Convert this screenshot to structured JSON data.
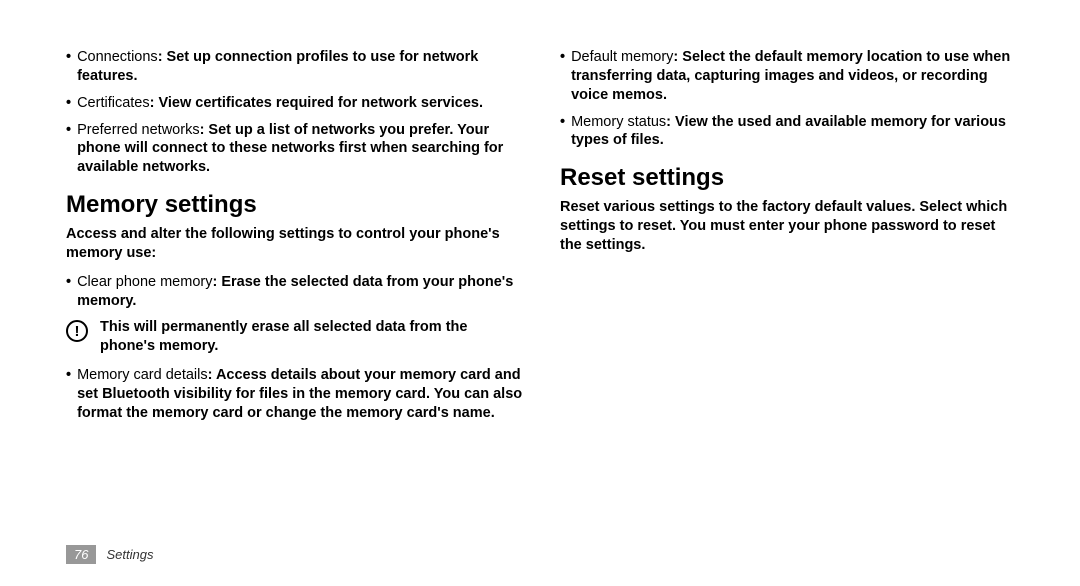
{
  "left_col": {
    "bullets_top": [
      {
        "label": "Connections",
        "desc": ": Set up connection profiles to use for network features."
      },
      {
        "label": "Certificates",
        "desc": ": View certificates required for network services."
      },
      {
        "label": "Preferred networks",
        "desc": ": Set up a list of networks you prefer. Your phone will connect to these networks first when searching for available networks."
      }
    ],
    "heading": "Memory settings",
    "intro": "Access and alter the following settings to control your phone's memory use:",
    "bullets_after": [
      {
        "label": "Clear phone memory",
        "desc": ": Erase the selected data from your phone's memory."
      }
    ],
    "warning": "This will permanently erase all selected data from the phone's memory.",
    "bullets_last": [
      {
        "label": "Memory card details",
        "desc": ": Access details about your memory card and set Bluetooth visibility for files in the memory card. You can also format the memory card or change the memory card's name."
      }
    ]
  },
  "right_col": {
    "bullets_top": [
      {
        "label": "Default memory",
        "desc": ": Select the default memory location to use when transferring data, capturing images and videos, or recording voice memos."
      },
      {
        "label": "Memory status",
        "desc": ": View the used and available memory for various types of files."
      }
    ],
    "heading": "Reset settings",
    "intro": "Reset various settings to the factory default values. Select which settings to reset. You must enter your phone password to reset the settings."
  },
  "footer": {
    "page": "76",
    "section": "Settings"
  }
}
